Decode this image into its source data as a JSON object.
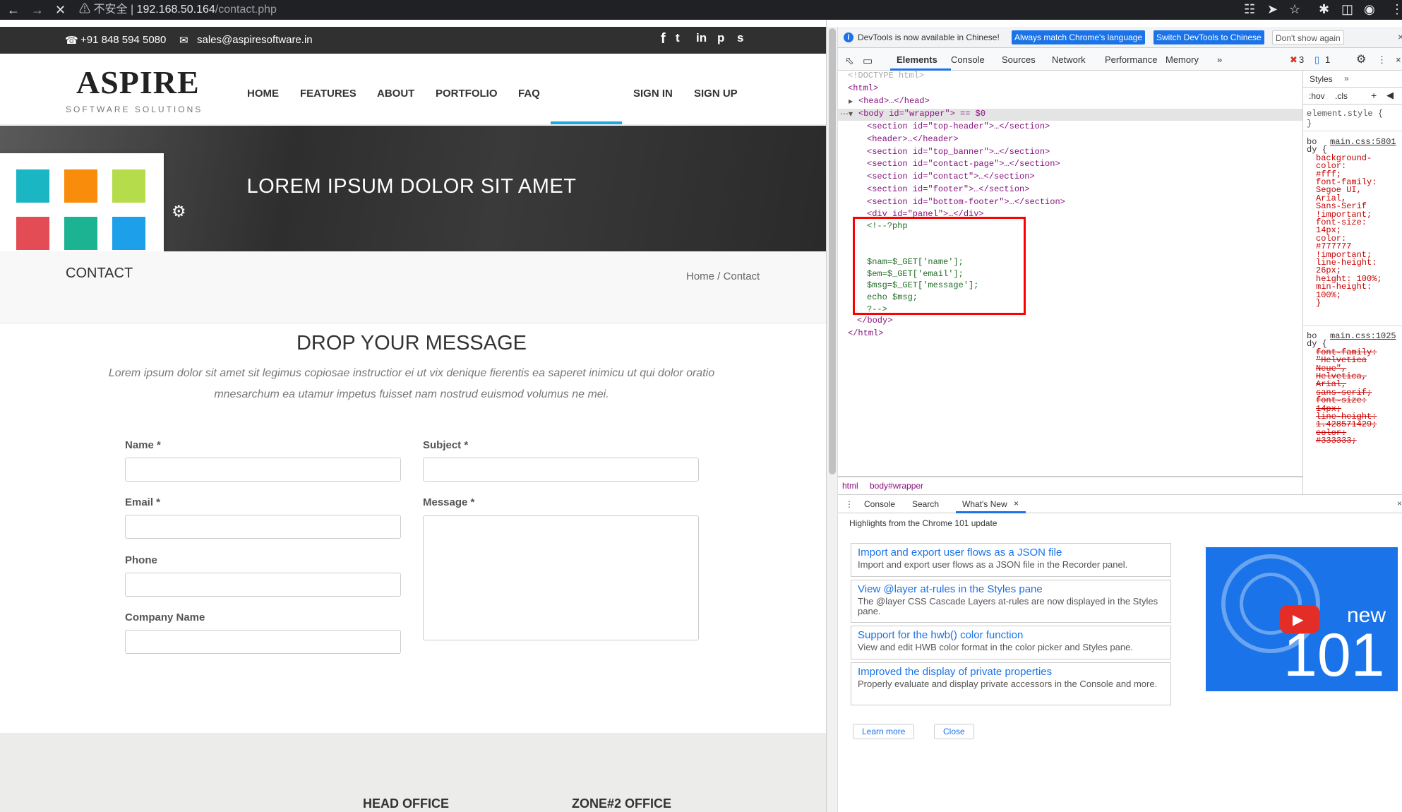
{
  "browser": {
    "security": "不安全",
    "url_host": "192.168.50.164",
    "url_path": "/contact.php"
  },
  "top_header": {
    "phone": "+91 848 594 5080",
    "email": "sales@aspiresoftware.in",
    "social": [
      "f",
      "t",
      "in",
      "p",
      "s"
    ]
  },
  "header": {
    "logo_title": "ASPIRE",
    "logo_sub": "SOFTWARE SOLUTIONS",
    "menu": [
      "HOME",
      "FEATURES",
      "ABOUT",
      "PORTFOLIO",
      "FAQ",
      "SIGN IN",
      "SIGN UP"
    ]
  },
  "banner": {
    "title": "LOREM IPSUM DOLOR SIT AMET"
  },
  "swatches": [
    "#1ab6c3",
    "#f98c0a",
    "#b4dc4b",
    "#e34c55",
    "#1cb393",
    "#1d9fea"
  ],
  "contact_bar": {
    "title": "CONTACT",
    "breadcrumb": "Home / Contact"
  },
  "form_section": {
    "title": "DROP YOUR MESSAGE",
    "text_line1": "Lorem ipsum dolor sit amet sit legimus copiosae instructior ei ut vix denique fierentis ea saperet inimicu ut qui dolor oratio",
    "text_line2": "mnesarchum ea utamur impetus fuisset nam nostrud euismod volumus ne mei.",
    "labels": {
      "name": "Name *",
      "subject": "Subject *",
      "email": "Email *",
      "message": "Message *",
      "phone": "Phone",
      "company": "Company Name"
    }
  },
  "offices": {
    "head": "HEAD OFFICE",
    "zone2": "ZONE#2 OFFICE"
  },
  "devtools": {
    "info_text": "DevTools is now available in Chinese!",
    "btn_match": "Always match Chrome's language",
    "btn_switch": "Switch DevTools to Chinese",
    "btn_dont": "Don't show again",
    "tabs": [
      "Elements",
      "Console",
      "Sources",
      "Network",
      "Performance",
      "Memory"
    ],
    "error_count": "3",
    "message_count": "1",
    "dom_lines": [
      "<!DOCTYPE html>",
      "<html>",
      "<head>…</head>",
      "<body id=\"wrapper\"> == $0",
      "<section id=\"top-header\">…</section>",
      "<header>…</header>",
      "<section id=\"top_banner\">…</section>",
      "<section id=\"contact-page\">…</section>",
      "<section id=\"contact\">…</section>",
      "<section id=\"footer\">…</section>",
      "<section id=\"bottom-footer\">…</section>",
      "<div id=\"panel\">…</div>",
      "<!--?php",
      "$nam=$_GET['name'];",
      "$em=$_GET['email'];",
      "$msg=$_GET['message'];",
      "echo $msg;",
      "?-->",
      "</body>",
      "</html>"
    ],
    "breadcrumb_html": "html",
    "breadcrumb_body": "body#wrapper",
    "styles": {
      "tab": "Styles",
      "hov": ":hov",
      "cls": ".cls",
      "element_style": "element.style {",
      "brace": "}",
      "src1": "main.css:5801",
      "src2": "main.css:1025",
      "rule1": [
        "bo",
        "dy {",
        "background-",
        "color:",
        "#fff;",
        "font-family:",
        "Segoe UI,",
        "Arial,",
        "Sans-Serif",
        "!important;",
        "font-size:",
        "14px;",
        "color:",
        "#777777",
        "!important;",
        "line-height:",
        "26px;",
        "height: 100%;",
        "min-height:",
        "100%;",
        "}"
      ],
      "rule2": [
        "bo",
        "dy {",
        "font-family:",
        "\"Helvetica",
        "Neue\",",
        "Helvetica,",
        "Arial,",
        "sans-serif;",
        "font-size:",
        "14px;",
        "line-height:",
        "1.428571429;",
        "color:",
        "#333333;"
      ]
    },
    "drawer_tabs": [
      "Console",
      "Search",
      "What's New"
    ],
    "highlights": "Highlights from the Chrome 101 update",
    "cards": [
      {
        "title": "Import and export user flows as a JSON file",
        "desc": "Import and export user flows as a JSON file in the Recorder panel."
      },
      {
        "title": "View @layer at-rules in the Styles pane",
        "desc": "The @layer CSS Cascade Layers at-rules are now displayed in the Styles pane."
      },
      {
        "title": "Support for the hwb() color function",
        "desc": "View and edit HWB color format in the color picker and Styles pane."
      },
      {
        "title": "Improved the display of private properties",
        "desc": "Properly evaluate and display private accessors in the Console and more."
      }
    ],
    "learn_more": "Learn more",
    "close": "Close",
    "promo_new": "new",
    "promo_num": "101"
  }
}
